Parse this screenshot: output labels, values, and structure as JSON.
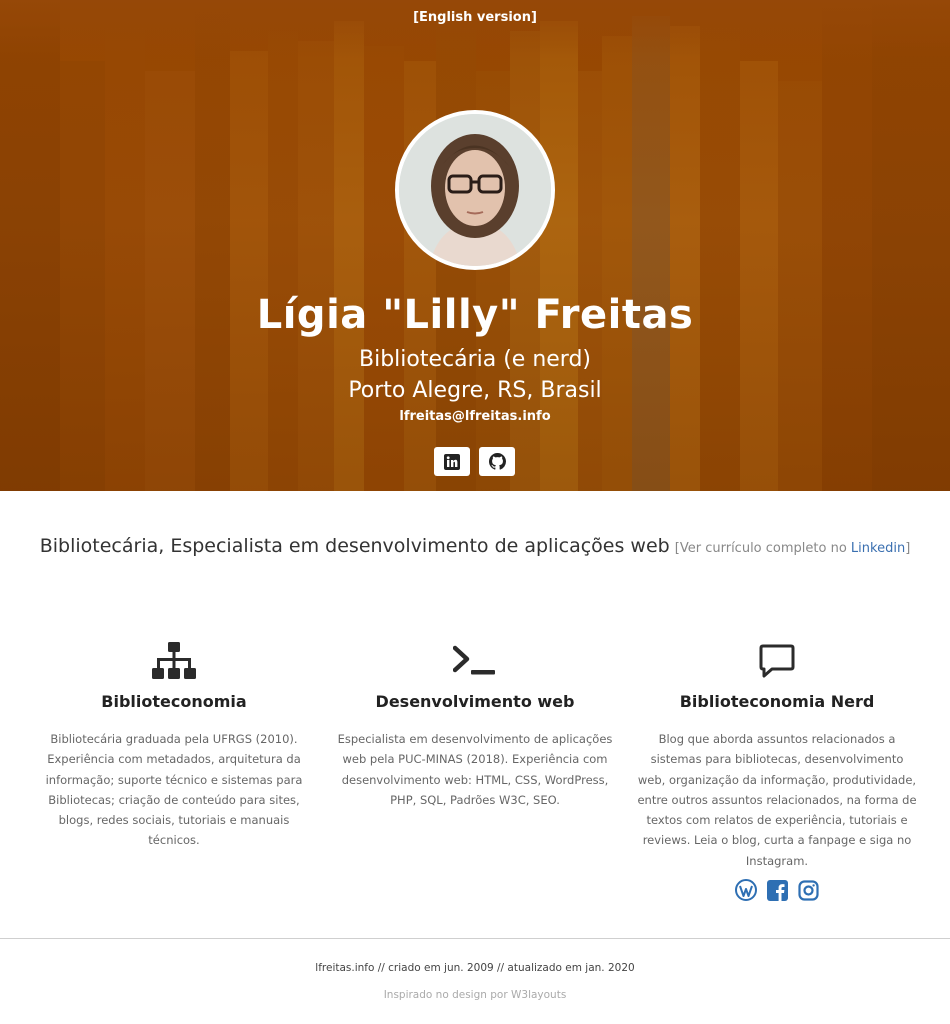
{
  "hero": {
    "language_link": "[English version]",
    "name": "Lígia \"Lilly\" Freitas",
    "role": "Bibliotecária (e nerd)",
    "location": "Porto Alegre, RS, Brasil",
    "email": "lfreitas@lfreitas.info",
    "social": [
      {
        "icon": "linkedin-icon"
      },
      {
        "icon": "github-icon"
      }
    ],
    "background_color": "#9a4a06"
  },
  "tagline": {
    "text": "Bibliotecária, Especialista em desenvolvimento de aplicações web",
    "cv_prefix": "[Ver currículo completo no",
    "cv_link": "Linkedin",
    "cv_suffix": "]"
  },
  "features": [
    {
      "icon": "sitemap-icon",
      "title": "Biblioteconomia",
      "text": "Bibliotecária graduada pela UFRGS (2010). Experiência com metadados, arquitetura da informação; suporte técnico e sistemas para Bibliotecas; criação de conteúdo para sites, blogs, redes sociais, tutoriais e manuais técnicos."
    },
    {
      "icon": "terminal-icon",
      "title": "Desenvolvimento web",
      "text": "Especialista em desenvolvimento de aplicações web pela PUC-MINAS (2018). Experiência com desenvolvimento web: HTML, CSS, WordPress, PHP, SQL, Padrões W3C, SEO."
    },
    {
      "icon": "comment-icon",
      "title": "Biblioteconomia Nerd",
      "text": "Blog que aborda assuntos relacionados a sistemas para bibliotecas, desenvolvimento web, organização da informação, produtividade, entre outros assuntos relacionados, na forma de textos com relatos de experiência, tutoriais e reviews. Leia o blog, curta a fanpage e siga no Instagram.",
      "links": [
        {
          "icon": "wordpress-icon"
        },
        {
          "icon": "facebook-icon"
        },
        {
          "icon": "instagram-icon"
        }
      ]
    }
  ],
  "footer": {
    "line": "lfreitas.info // criado em jun. 2009 // atualizado em jan. 2020",
    "credit": "Inspirado no design por W3layouts"
  },
  "colors": {
    "accent_link": "#3a6fb0",
    "blog_icon": "#2e6fb3",
    "icon_dark": "#2b2b2b"
  }
}
